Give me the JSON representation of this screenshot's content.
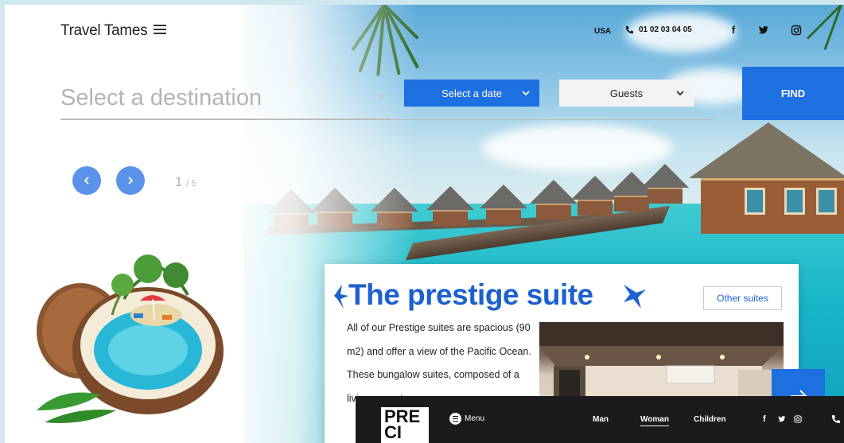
{
  "header": {
    "brand": "Travel Tames",
    "region": "USA",
    "phone": "01 02 03 04 05",
    "social": [
      {
        "icon": "facebook-icon",
        "glyph": "f"
      },
      {
        "icon": "twitter-icon",
        "glyph": "t"
      },
      {
        "icon": "instagram-icon",
        "glyph": "ig"
      }
    ]
  },
  "search": {
    "destination_placeholder": "Select a destination",
    "date_label": "Select a date",
    "guests_label": "Guests",
    "find_label": "FIND"
  },
  "slider": {
    "current": "1",
    "total": "/ 5"
  },
  "suite": {
    "title": "The prestige suite",
    "other_label": "Other suites",
    "description": "All of our Prestige suites are spacious (90 m2) and offer a view of the Pacific Ocean. These bungalow suites, composed of a living room, two se"
  },
  "overlay": {
    "logo_line1": "PRE",
    "logo_line2": "CI",
    "menu_label": "Menu",
    "nav": [
      "Man",
      "Woman",
      "Children"
    ],
    "active_nav": "Woman"
  },
  "colors": {
    "accent": "#1e6fe0",
    "title_blue": "#1c61cf",
    "slider_button": "#5b93ea"
  }
}
